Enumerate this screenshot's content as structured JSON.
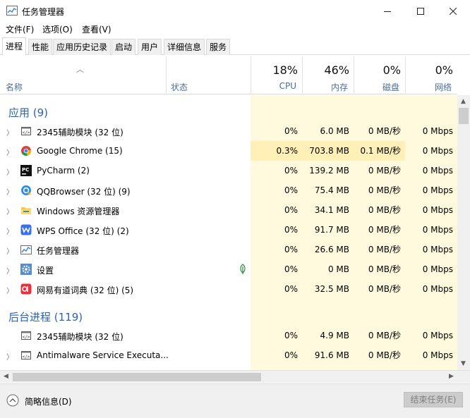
{
  "window": {
    "title": "任务管理器"
  },
  "menu": [
    "文件(F)",
    "选项(O)",
    "查看(V)"
  ],
  "tabs": [
    "进程",
    "性能",
    "应用历史记录",
    "启动",
    "用户",
    "详细信息",
    "服务"
  ],
  "header": {
    "name": "名称",
    "status": "状态",
    "cpu": {
      "pct": "18%",
      "label": "CPU"
    },
    "mem": {
      "pct": "46%",
      "label": "内存"
    },
    "disk": {
      "pct": "0%",
      "label": "磁盘"
    },
    "net": {
      "pct": "0%",
      "label": "网络"
    }
  },
  "groups": {
    "apps": "应用 (9)",
    "background": "后台进程 (119)"
  },
  "apps": [
    {
      "name": "2345辅助模块 (32 位)",
      "cpu": "0%",
      "mem": "6.0 MB",
      "disk": "0 MB/秒",
      "net": "0 Mbps",
      "icon": "generic-app-icon"
    },
    {
      "name": "Google Chrome (15)",
      "cpu": "0.3%",
      "mem": "703.8 MB",
      "disk": "0.1 MB/秒",
      "net": "0 Mbps",
      "icon": "chrome-icon"
    },
    {
      "name": "PyCharm (2)",
      "cpu": "0%",
      "mem": "139.2 MB",
      "disk": "0 MB/秒",
      "net": "0 Mbps",
      "icon": "pycharm-icon"
    },
    {
      "name": "QQBrowser (32 位) (9)",
      "cpu": "0%",
      "mem": "75.4 MB",
      "disk": "0 MB/秒",
      "net": "0 Mbps",
      "icon": "qqbrowser-icon"
    },
    {
      "name": "Windows 资源管理器",
      "cpu": "0%",
      "mem": "34.1 MB",
      "disk": "0 MB/秒",
      "net": "0 Mbps",
      "icon": "explorer-folder-icon"
    },
    {
      "name": "WPS Office (32 位) (2)",
      "cpu": "0%",
      "mem": "91.7 MB",
      "disk": "0 MB/秒",
      "net": "0 Mbps",
      "icon": "wps-icon"
    },
    {
      "name": "任务管理器",
      "cpu": "0%",
      "mem": "26.6 MB",
      "disk": "0 MB/秒",
      "net": "0 Mbps",
      "icon": "task-manager-icon"
    },
    {
      "name": "设置",
      "cpu": "0%",
      "mem": "0 MB",
      "disk": "0 MB/秒",
      "net": "0 Mbps",
      "icon": "settings-gear-icon"
    },
    {
      "name": "网易有道词典 (32 位) (5)",
      "cpu": "0%",
      "mem": "32.5 MB",
      "disk": "0 MB/秒",
      "net": "0 Mbps",
      "icon": "youdao-icon"
    }
  ],
  "background": [
    {
      "name": "2345辅助模块 (32 位)",
      "cpu": "0%",
      "mem": "4.9 MB",
      "disk": "0 MB/秒",
      "net": "0 Mbps",
      "icon": "generic-app-icon"
    },
    {
      "name": "Antimalware Service Executa...",
      "cpu": "0%",
      "mem": "91.6 MB",
      "disk": "0 MB/秒",
      "net": "0 Mbps",
      "icon": "generic-app-icon"
    }
  ],
  "footer": {
    "less_details": "简略信息(D)",
    "end_task": "结束任务(E)"
  },
  "colors": {
    "accent": "#2b63b7",
    "heat_light": "#fff9dd",
    "heat_medium": "#fff0b8"
  }
}
